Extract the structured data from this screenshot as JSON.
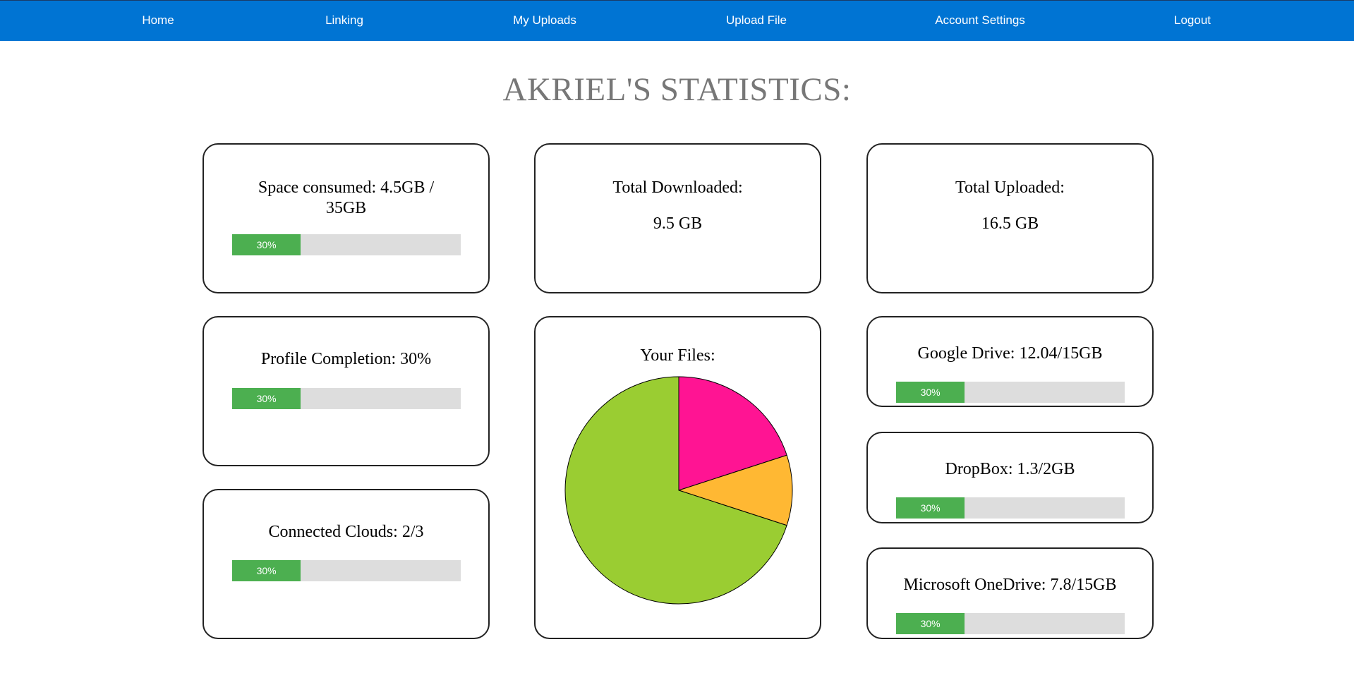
{
  "nav": {
    "items": [
      "Home",
      "Linking",
      "My Uploads",
      "Upload File",
      "Account Settings",
      "Logout"
    ]
  },
  "page": {
    "title": "AKRIEL'S STATISTICS:"
  },
  "space": {
    "label": "Space consumed: 4.5GB / 35GB",
    "progress_label": "30%",
    "progress": 0.3
  },
  "downloaded": {
    "label": "Total Downloaded:",
    "value": "9.5 GB"
  },
  "uploaded": {
    "label": "Total Uploaded:",
    "value": "16.5 GB"
  },
  "profile": {
    "label": "Profile Completion: 30%",
    "progress_label": "30%",
    "progress": 0.3
  },
  "clouds": {
    "label": "Connected Clouds: 2/3",
    "progress_label": "30%",
    "progress": 0.3
  },
  "files": {
    "label": "Your Files:",
    "colors": [
      "#ff1493",
      "#ffb833",
      "#9acd32"
    ]
  },
  "google_drive": {
    "label": "Google Drive: 12.04/15GB",
    "progress_label": "30%",
    "progress": 0.3
  },
  "dropbox": {
    "label": "DropBox: 1.3/2GB",
    "progress_label": "30%",
    "progress": 0.3
  },
  "onedrive": {
    "label": "Microsoft OneDrive: 7.8/15GB",
    "progress_label": "30%",
    "progress": 0.3
  },
  "chart_data": {
    "type": "pie",
    "title": "Your Files:",
    "values": [
      0.2,
      0.1,
      0.7
    ],
    "colors": [
      "#ff1493",
      "#ffb833",
      "#9acd32"
    ]
  }
}
